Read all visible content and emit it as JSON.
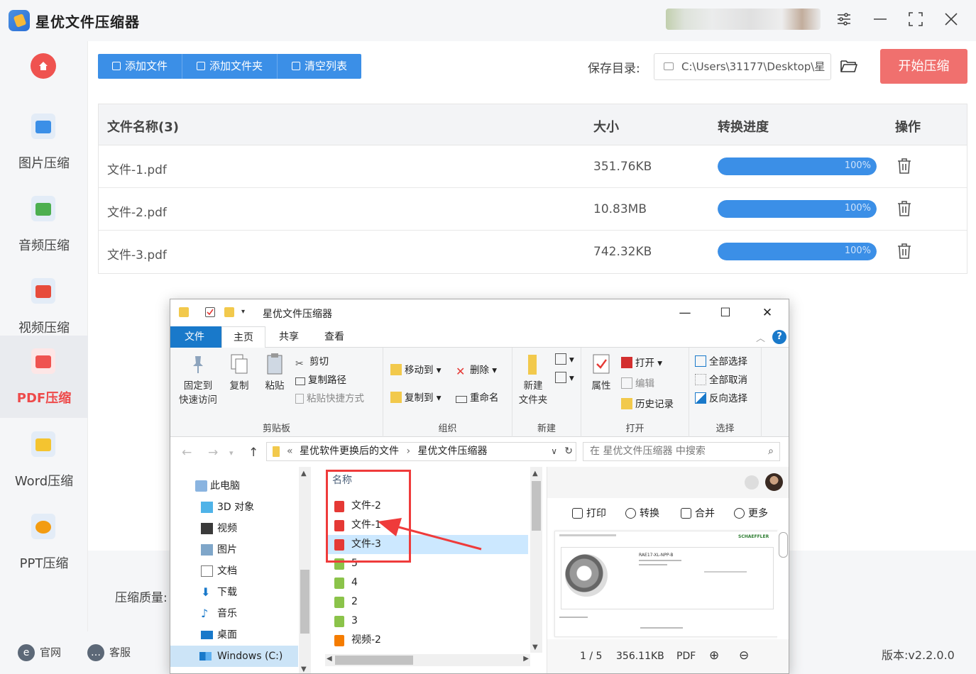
{
  "app": {
    "title": "星优文件压缩器"
  },
  "sidebar": {
    "items": [
      {
        "label": "图片压缩",
        "color": "#3b8fe7"
      },
      {
        "label": "音频压缩",
        "color": "#4caf50"
      },
      {
        "label": "视频压缩",
        "color": "#e74c3c"
      },
      {
        "label": "PDF压缩",
        "color": "#ef5350"
      },
      {
        "label": "Word压缩",
        "color": "#f4c430"
      },
      {
        "label": "PPT压缩",
        "color": "#f39c12"
      }
    ],
    "active_index": 3
  },
  "toolbar": {
    "add_file": "添加文件",
    "add_folder": "添加文件夹",
    "clear_list": "清空列表",
    "save_label": "保存目录:",
    "save_path": "C:\\Users\\31177\\Desktop\\星",
    "start_button": "开始压缩"
  },
  "table": {
    "headers": {
      "name": "文件名称(3)",
      "size": "大小",
      "progress": "转换进度",
      "action": "操作"
    },
    "rows": [
      {
        "name": "文件-1.pdf",
        "size": "351.76KB",
        "progress": "100%",
        "progress_fraction": 1.0
      },
      {
        "name": "文件-2.pdf",
        "size": "10.83MB",
        "progress": "100%",
        "progress_fraction": 1.0
      },
      {
        "name": "文件-3.pdf",
        "size": "742.32KB",
        "progress": "100%",
        "progress_fraction": 1.0
      }
    ]
  },
  "quality_label": "压缩质量:",
  "footer": {
    "website": "官网",
    "service": "客服",
    "version": "版本:v2.2.0.0"
  },
  "explorer": {
    "title": "星优文件压缩器",
    "tabs": [
      "文件",
      "主页",
      "共享",
      "查看"
    ],
    "ribbon": {
      "clipboard": {
        "group": "剪贴板",
        "pin": [
          "固定到",
          "快速访问"
        ],
        "copy": "复制",
        "paste": "粘贴",
        "cut": "剪切",
        "copy_path": "复制路径",
        "paste_shortcut": "粘贴快捷方式"
      },
      "organize": {
        "group": "组织",
        "move_to": "移动到",
        "copy_to": "复制到",
        "delete": "删除",
        "rename": "重命名"
      },
      "new": {
        "group": "新建",
        "new_folder": [
          "新建",
          "文件夹"
        ]
      },
      "open": {
        "group": "打开",
        "properties": "属性",
        "open": "打开",
        "edit": "编辑",
        "history": "历史记录"
      },
      "select": {
        "group": "选择",
        "select_all": "全部选择",
        "select_none": "全部取消",
        "invert": "反向选择"
      }
    },
    "address": {
      "prefix": "«",
      "crumb1": "星优软件更换后的文件",
      "sep": "›",
      "crumb2": "星优文件压缩器",
      "search_placeholder": "在 星优文件压缩器 中搜索"
    },
    "nav": [
      {
        "label": "此电脑"
      },
      {
        "label": "3D 对象"
      },
      {
        "label": "视频"
      },
      {
        "label": "图片"
      },
      {
        "label": "文档"
      },
      {
        "label": "下载"
      },
      {
        "label": "音乐"
      },
      {
        "label": "桌面"
      },
      {
        "label": "Windows (C:)"
      }
    ],
    "files": {
      "header": "名称",
      "items": [
        {
          "name": "文件-2",
          "type": "pdf"
        },
        {
          "name": "文件-1",
          "type": "pdf"
        },
        {
          "name": "文件-3",
          "type": "pdf"
        },
        {
          "name": "5",
          "type": "img"
        },
        {
          "name": "4",
          "type": "img"
        },
        {
          "name": "2",
          "type": "img"
        },
        {
          "name": "3",
          "type": "img"
        },
        {
          "name": "视频-2",
          "type": "video"
        }
      ],
      "selected_index": 2
    },
    "preview": {
      "tools": [
        "打印",
        "转换",
        "合并",
        "更多"
      ],
      "page": "1 / 5",
      "size": "356.11KB",
      "format": "PDF",
      "doc_brand": "SCHAEFFLER",
      "doc_model": "RAE17-XL-NPP-B"
    }
  }
}
